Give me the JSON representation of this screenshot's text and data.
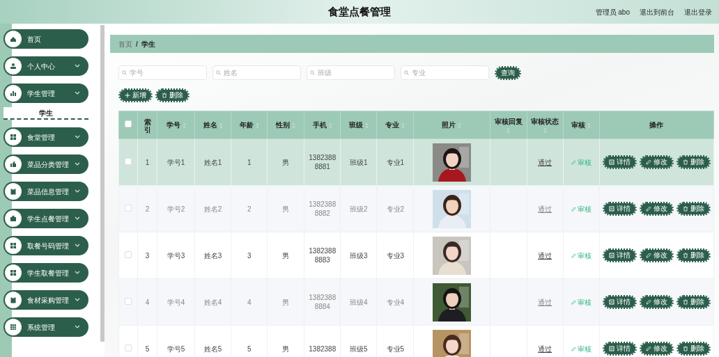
{
  "header": {
    "title": "食堂点餐管理",
    "links": [
      "管理员 abo",
      "退出到前台",
      "退出登录"
    ]
  },
  "sidebar": {
    "items": [
      {
        "label": "首页",
        "kind": "link"
      },
      {
        "label": "个人中心",
        "kind": "submenu"
      },
      {
        "label": "学生管理",
        "kind": "submenu",
        "children": [
          {
            "label": "学生",
            "selected": true
          }
        ]
      },
      {
        "label": "食堂管理",
        "kind": "submenu"
      },
      {
        "label": "菜品分类管理",
        "kind": "submenu"
      },
      {
        "label": "菜品信息管理",
        "kind": "submenu"
      },
      {
        "label": "学生点餐管理",
        "kind": "submenu"
      },
      {
        "label": "取餐号码管理",
        "kind": "submenu"
      },
      {
        "label": "学生取餐管理",
        "kind": "submenu"
      },
      {
        "label": "食材采购管理",
        "kind": "submenu"
      },
      {
        "label": "系统管理",
        "kind": "submenu"
      }
    ]
  },
  "breadcrumb": {
    "items": [
      "首页",
      "学生"
    ],
    "separator": "/"
  },
  "search": {
    "fields": [
      {
        "placeholder": "学号"
      },
      {
        "placeholder": "姓名"
      },
      {
        "placeholder": "班级"
      },
      {
        "placeholder": "专业"
      }
    ],
    "button": "查询"
  },
  "actions": [
    "新增",
    "删除"
  ],
  "table": {
    "select_all": {
      "checked": false
    },
    "columns": [
      {
        "label": "索引",
        "sortable": false
      },
      {
        "label": "学号",
        "sortable": true
      },
      {
        "label": "姓名",
        "sortable": true
      },
      {
        "label": "年龄",
        "sortable": true
      },
      {
        "label": "性别",
        "sortable": true
      },
      {
        "label": "手机",
        "sortable": true
      },
      {
        "label": "班级",
        "sortable": true
      },
      {
        "label": "专业",
        "sortable": true
      },
      {
        "label": "照片",
        "sortable": true
      },
      {
        "label": "审核回复",
        "sortable": true
      },
      {
        "label": "审核状态",
        "sortable": true
      },
      {
        "label": "审核",
        "sortable": true
      },
      {
        "label": "操作",
        "sortable": false
      }
    ],
    "rows": [
      {
        "checked": false,
        "highlighted": true,
        "index": "1",
        "id": "学号1",
        "name": "姓名1",
        "age": "1",
        "gender": "男",
        "phone": "13823888881",
        "class": "班级1",
        "major": "专业1",
        "photo": {
          "kind": "picture"
        },
        "status": "通过",
        "audit": "审核",
        "buttons": [
          "详情",
          "修改",
          "删除"
        ]
      },
      {
        "checked": false,
        "highlighted": false,
        "index": "2",
        "id": "学号2",
        "name": "姓名2",
        "age": "2",
        "gender": "男",
        "phone": "13823888882",
        "class": "班级2",
        "major": "专业2",
        "photo": {
          "kind": "picture"
        },
        "status": "通过",
        "audit": "审核",
        "buttons": [
          "详情",
          "修改",
          "删除"
        ]
      },
      {
        "checked": false,
        "highlighted": false,
        "index": "3",
        "id": "学号3",
        "name": "姓名3",
        "age": "3",
        "gender": "男",
        "phone": "13823888883",
        "class": "班级3",
        "major": "专业3",
        "photo": {
          "kind": "picture"
        },
        "status": "通过",
        "audit": "审核",
        "buttons": [
          "详情",
          "修改",
          "删除"
        ]
      },
      {
        "checked": false,
        "highlighted": false,
        "index": "4",
        "id": "学号4",
        "name": "姓名4",
        "age": "4",
        "gender": "男",
        "phone": "13823888884",
        "class": "班级4",
        "major": "专业4",
        "photo": {
          "kind": "picture"
        },
        "status": "通过",
        "audit": "审核",
        "buttons": [
          "详情",
          "修改",
          "删除"
        ]
      },
      {
        "checked": false,
        "highlighted": false,
        "index": "5",
        "id": "学号5",
        "name": "姓名5",
        "age": "5",
        "gender": "男",
        "phone": "1382388",
        "class": "班级5",
        "major": "专业5",
        "photo": {
          "kind": "picture"
        },
        "status": "通过",
        "audit": "审核",
        "buttons": [
          "详情",
          "修改",
          "删除"
        ]
      }
    ]
  }
}
